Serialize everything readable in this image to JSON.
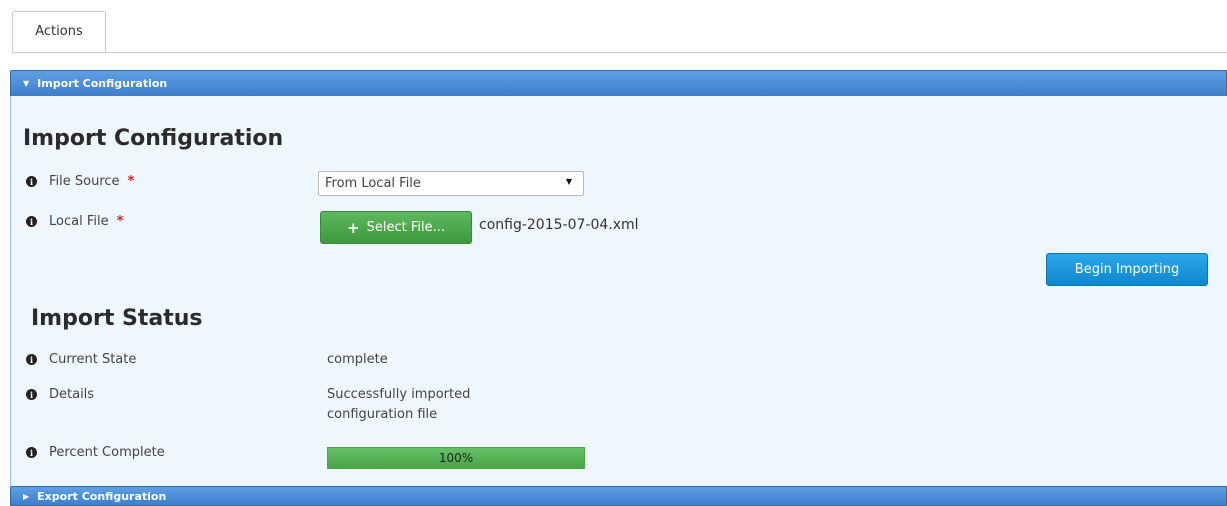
{
  "tabs": [
    {
      "label": "Actions",
      "active": true
    }
  ],
  "sections": {
    "import": {
      "header": "Import Configuration",
      "expanded": true
    },
    "export": {
      "header": "Export Configuration",
      "expanded": false
    }
  },
  "import_form": {
    "title": "Import Configuration",
    "file_source": {
      "label": "File Source",
      "required_mark": "*",
      "selected": "From Local File"
    },
    "local_file": {
      "label": "Local File",
      "required_mark": "*",
      "button_label": "Select File...",
      "button_icon": "+",
      "selected_file": "config-2015-07-04.xml"
    },
    "begin_button": "Begin Importing"
  },
  "import_status": {
    "title": "Import Status",
    "current_state": {
      "label": "Current State",
      "value": "complete"
    },
    "details": {
      "label": "Details",
      "value_line1": "Successfully imported",
      "value_line2": "configuration file"
    },
    "percent_complete": {
      "label": "Percent Complete",
      "value": 100,
      "text": "100%"
    }
  },
  "icons": {
    "info": "i",
    "expanded_caret": "▼",
    "collapsed_caret": "▶",
    "select_arrow": "▼"
  },
  "colors": {
    "header_blue": "#3c7fcb",
    "panel_bg": "#eef6fe",
    "green_button": "#47a447",
    "blue_button": "#0e86cc",
    "required_red": "#d62020"
  }
}
